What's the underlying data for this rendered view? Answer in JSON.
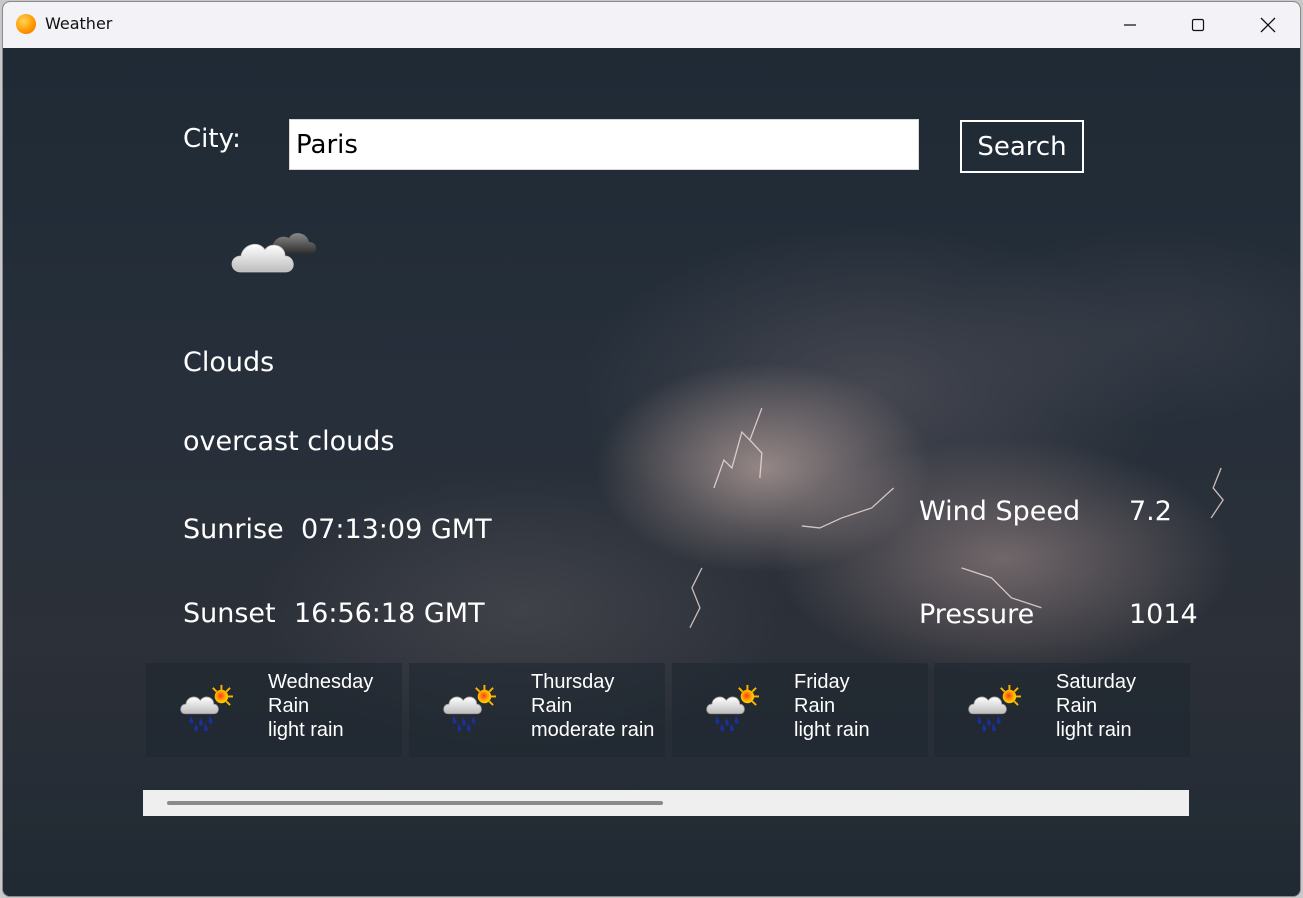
{
  "window": {
    "title": "Weather",
    "icon": "orange-circle-icon"
  },
  "search": {
    "label": "City:",
    "value": "Paris",
    "button_label": "Search"
  },
  "current": {
    "icon": "cloudy-icon",
    "main": "Clouds",
    "description": "overcast clouds",
    "sunrise_label": "Sunrise",
    "sunrise": "07:13:09 GMT",
    "sunset_label": "Sunset",
    "sunset": "16:56:18 GMT",
    "wind_label": "Wind Speed",
    "wind": "7.2",
    "pressure_label": "Pressure",
    "pressure": "1014"
  },
  "forecast": [
    {
      "day": "Wednesday",
      "main": "Rain",
      "description": "light rain",
      "icon": "rain-sun-icon"
    },
    {
      "day": "Thursday",
      "main": "Rain",
      "description": "moderate rain",
      "icon": "rain-sun-icon"
    },
    {
      "day": "Friday",
      "main": "Rain",
      "description": "light rain",
      "icon": "rain-sun-icon"
    },
    {
      "day": "Saturday",
      "main": "Rain",
      "description": "light rain",
      "icon": "rain-sun-icon"
    }
  ],
  "colors": {
    "text": "#ffffff",
    "background": "#1f2a35",
    "titlebar": "#f3f3f7"
  }
}
